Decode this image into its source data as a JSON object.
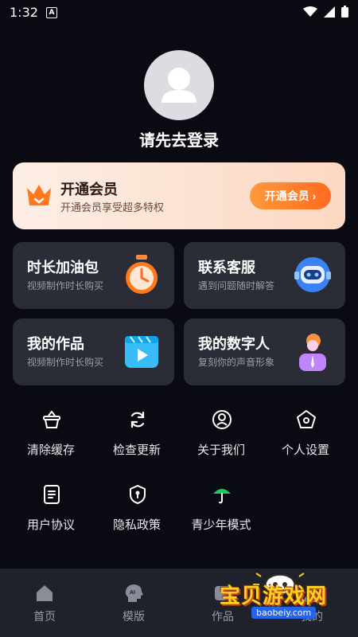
{
  "status": {
    "time": "1:32",
    "a_badge": "A"
  },
  "profile": {
    "login_prompt": "请先去登录"
  },
  "vip": {
    "title": "开通会员",
    "subtitle": "开通会员享受超多特权",
    "button": "开通会员 ›"
  },
  "cards": [
    {
      "title": "时长加油包",
      "subtitle": "视频制作时长购买",
      "icon": "timer-icon"
    },
    {
      "title": "联系客服",
      "subtitle": "遇到问题随时解答",
      "icon": "robot-icon"
    },
    {
      "title": "我的作品",
      "subtitle": "视频制作时长购买",
      "icon": "play-video-icon"
    },
    {
      "title": "我的数字人",
      "subtitle": "复刻你的声音形象",
      "icon": "digital-person-icon"
    }
  ],
  "grid": [
    {
      "label": "清除缓存",
      "icon": "basket-icon"
    },
    {
      "label": "检查更新",
      "icon": "refresh-icon"
    },
    {
      "label": "关于我们",
      "icon": "user-circle-icon"
    },
    {
      "label": "个人设置",
      "icon": "settings-pentagon-icon"
    },
    {
      "label": "用户协议",
      "icon": "document-icon"
    },
    {
      "label": "隐私政策",
      "icon": "shield-icon"
    },
    {
      "label": "青少年模式",
      "icon": "umbrella-icon"
    }
  ],
  "nav": [
    {
      "label": "首页",
      "icon": "home-icon"
    },
    {
      "label": "模版",
      "icon": "ai-head-icon"
    },
    {
      "label": "作品",
      "icon": "works-icon"
    },
    {
      "label": "我的",
      "icon": "profile-icon"
    }
  ],
  "watermark": {
    "text": "宝贝游戏网",
    "url": "baobeiy.com"
  },
  "colors": {
    "background": "#0a0b12",
    "card": "#2a2c36",
    "accent": "#ff6b1f",
    "nav": "#1f212b"
  }
}
